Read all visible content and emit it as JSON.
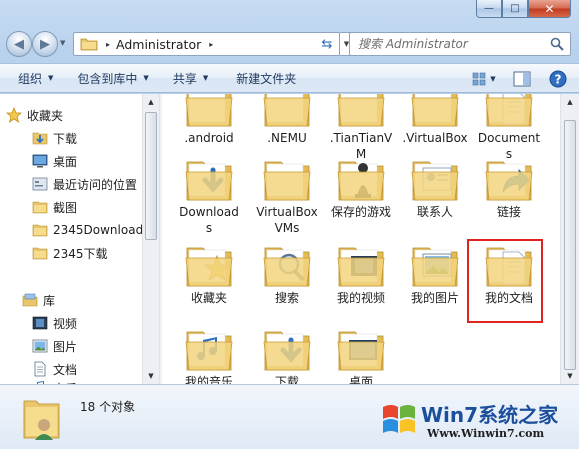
{
  "window": {
    "controls": {
      "minimize": "—",
      "maximize": "□",
      "close": "✕"
    }
  },
  "address": {
    "path": "Administrator",
    "arrow": "▸",
    "search_placeholder": "搜索 Administrator"
  },
  "toolbar": {
    "organize": "组织",
    "include_in_library": "包含到库中",
    "share": "共享",
    "new_folder": "新建文件夹"
  },
  "nav_pane": {
    "favorites": {
      "label": "收藏夹",
      "items": [
        "下载",
        "桌面",
        "最近访问的位置",
        "截图",
        "2345Downloads",
        "2345下载"
      ]
    },
    "libraries": {
      "label": "库",
      "items": [
        "视频",
        "图片",
        "文档",
        "音乐"
      ]
    }
  },
  "files": [
    [
      ".android"
    ],
    [
      ".NEMU"
    ],
    [
      ".TianTianV",
      "M"
    ],
    [
      ".VirtualBox"
    ],
    [
      "Document",
      "s"
    ],
    [
      "Download",
      "s"
    ],
    [
      "VirtualBox",
      "VMs"
    ],
    [
      "保存的游戏"
    ],
    [
      "联系人"
    ],
    [
      "链接"
    ],
    [
      "收藏夹"
    ],
    [
      "搜索"
    ],
    [
      "我的视频"
    ],
    [
      "我的图片"
    ],
    [
      "我的文档"
    ],
    [
      "我的音乐"
    ],
    [
      "下载"
    ],
    [
      "桌面"
    ]
  ],
  "details": {
    "count": "18 个对象"
  },
  "watermark": {
    "title": "Win7系统之家",
    "url": "Www.Winwin7.com"
  }
}
